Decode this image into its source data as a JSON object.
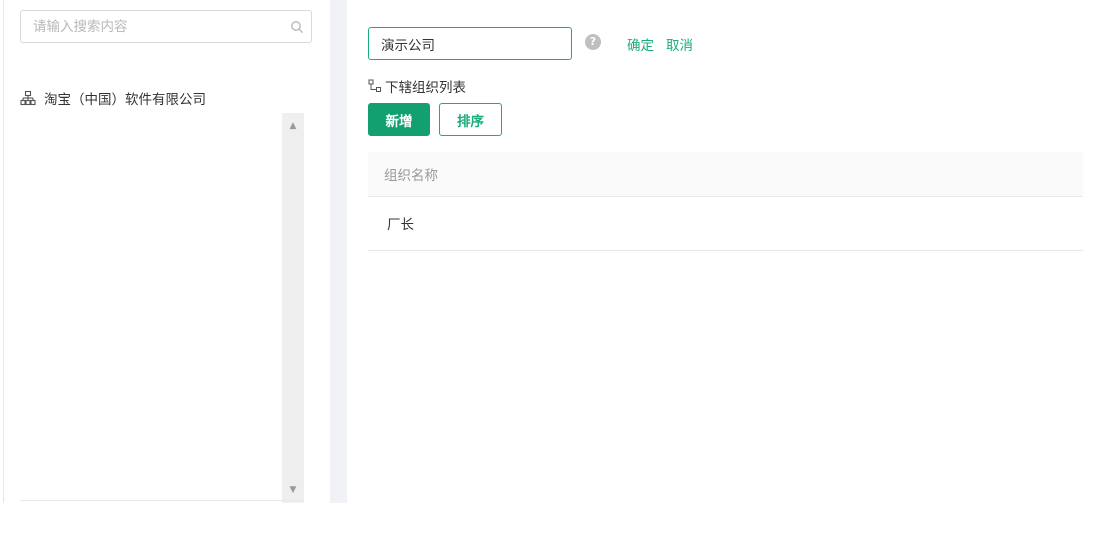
{
  "colors": {
    "accent": "#13a070",
    "accent_light": "#1aad7a",
    "gutter": "#f0f2f5",
    "table_header_bg": "#fafafa"
  },
  "sidebar": {
    "search_placeholder": "请输入搜索内容",
    "search_icon": "search-icon",
    "tree": [
      {
        "icon": "org-chart-icon",
        "label": "淘宝（中国）软件有限公司"
      }
    ],
    "scroll_up": "▲",
    "scroll_down": "▼"
  },
  "editor": {
    "name_value": "演示公司",
    "help_symbol": "?",
    "confirm_label": "确定",
    "cancel_label": "取消"
  },
  "sub_orgs": {
    "icon": "tree-structure-icon",
    "title": "下辖组织列表",
    "add_label": "新增",
    "sort_label": "排序",
    "table": {
      "columns": [
        "组织名称"
      ],
      "rows": [
        [
          "厂长"
        ]
      ]
    }
  }
}
